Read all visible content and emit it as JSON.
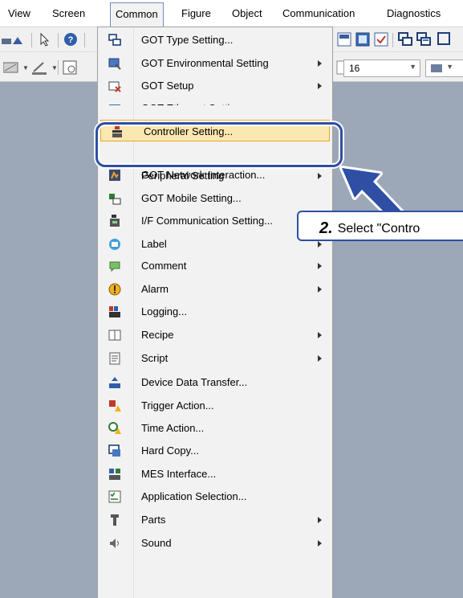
{
  "menubar": {
    "items": [
      {
        "label": "View"
      },
      {
        "label": "Screen"
      },
      {
        "label": "Common"
      },
      {
        "label": "Figure"
      },
      {
        "label": "Object"
      },
      {
        "label": "Communication"
      },
      {
        "label": "Diagnostics"
      }
    ],
    "active": "Common"
  },
  "toolbar": {
    "font_size_value": "16"
  },
  "common_menu": {
    "items": [
      {
        "label": "GOT Type Setting...",
        "icon": "got-type-icon",
        "submenu": false
      },
      {
        "label": "GOT Environmental Setting",
        "icon": "environment-icon",
        "submenu": true
      },
      {
        "label": "GOT Setup",
        "icon": "setup-icon",
        "submenu": true
      },
      {
        "label": "GOT Ethernet Setting",
        "icon": "ethernet-icon",
        "submenu": true
      },
      {
        "label": "Controller Setting...",
        "icon": "controller-icon",
        "submenu": false,
        "highlighted": true
      },
      {
        "label": "Peripheral Setting",
        "icon": "peripheral-icon",
        "submenu": true
      },
      {
        "label": "GOT Network Interaction...",
        "icon": "network-icon",
        "submenu": false
      },
      {
        "label": "GOT Mobile Setting...",
        "icon": "mobile-icon",
        "submenu": false
      },
      {
        "label": "I/F Communication Setting...",
        "icon": "if-communication-icon",
        "submenu": false
      },
      {
        "label": "Label",
        "icon": "label-icon",
        "submenu": true
      },
      {
        "label": "Comment",
        "icon": "comment-icon",
        "submenu": true
      },
      {
        "label": "Alarm",
        "icon": "alarm-icon",
        "submenu": true
      },
      {
        "label": "Logging...",
        "icon": "logging-icon",
        "submenu": false
      },
      {
        "label": "Recipe",
        "icon": "recipe-icon",
        "submenu": true
      },
      {
        "label": "Script",
        "icon": "script-icon",
        "submenu": true
      },
      {
        "label": "Device Data Transfer...",
        "icon": "device-data-transfer-icon",
        "submenu": false
      },
      {
        "label": "Trigger Action...",
        "icon": "trigger-action-icon",
        "submenu": false
      },
      {
        "label": "Time Action...",
        "icon": "time-action-icon",
        "submenu": false
      },
      {
        "label": "Hard Copy...",
        "icon": "hard-copy-icon",
        "submenu": false
      },
      {
        "label": "MES Interface...",
        "icon": "mes-interface-icon",
        "submenu": false
      },
      {
        "label": "Application Selection...",
        "icon": "application-selection-icon",
        "submenu": false
      },
      {
        "label": "Parts",
        "icon": "parts-icon",
        "submenu": true
      },
      {
        "label": "Sound",
        "icon": "sound-icon",
        "submenu": true
      }
    ]
  },
  "callout": {
    "step_number": "2.",
    "text": "Select \"Contro"
  },
  "colors": {
    "workspace": "#9ca7b8",
    "menu_background": "#f2f2f2",
    "highlight_fill": "#fbe7b0",
    "highlight_border": "#e1a92c",
    "callout_blue": "#2e4fa3"
  }
}
